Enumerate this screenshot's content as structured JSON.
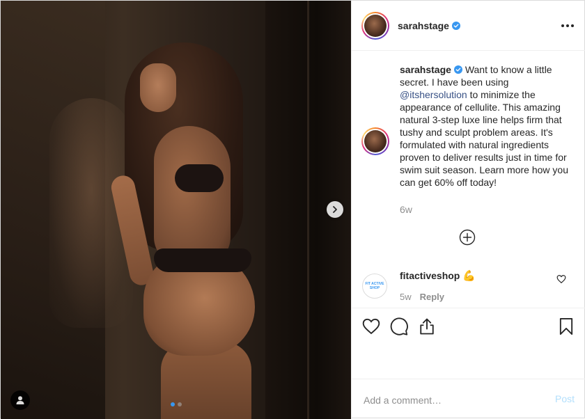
{
  "post": {
    "author": "sarahstage",
    "verified": true,
    "media": {
      "slide_count": 2,
      "active_slide": 1
    }
  },
  "caption": {
    "username": "sarahstage",
    "text_before": "Want to know a little secret. I have been using ",
    "mention": "@itshersolution",
    "text_after": " to minimize the appearance of cellulite. This amazing natural 3-step luxe line helps firm that tushy and sculpt problem areas. It's formulated with natural ingredients proven to deliver results just in time for swim suit season. Learn more how you can get 60% off today!",
    "time": "6w"
  },
  "comments": [
    {
      "username": "fitactiveshop",
      "text": "💪",
      "avatar_text": "FIT ACTIVE SHOP",
      "time": "5w",
      "reply_label": "Reply"
    }
  ],
  "add_comment": {
    "placeholder": "Add a comment…",
    "post_label": "Post"
  },
  "colors": {
    "verified_blue": "#3897f0",
    "post_button_disabled": "#b2dffc",
    "mention": "#385185",
    "muted_text": "#8e8e8e"
  },
  "icons": [
    "chevron-right-icon",
    "user-tag-icon",
    "verified-badge-icon",
    "more-options-icon",
    "load-more-comments-icon",
    "heart-icon",
    "comment-icon",
    "share-icon",
    "bookmark-icon"
  ]
}
